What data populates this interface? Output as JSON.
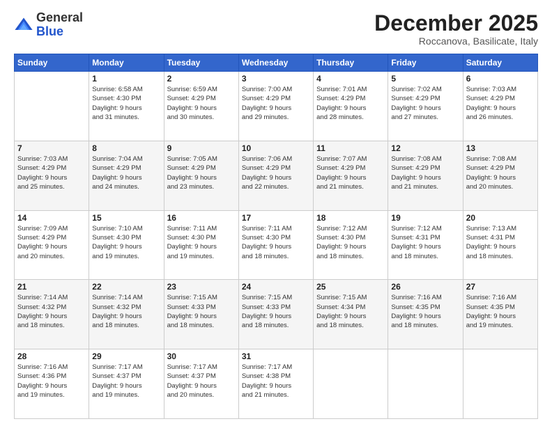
{
  "logo": {
    "general": "General",
    "blue": "Blue"
  },
  "title": "December 2025",
  "location": "Roccanova, Basilicate, Italy",
  "days_header": [
    "Sunday",
    "Monday",
    "Tuesday",
    "Wednesday",
    "Thursday",
    "Friday",
    "Saturday"
  ],
  "weeks": [
    [
      {
        "day": "",
        "info": ""
      },
      {
        "day": "1",
        "info": "Sunrise: 6:58 AM\nSunset: 4:30 PM\nDaylight: 9 hours\nand 31 minutes."
      },
      {
        "day": "2",
        "info": "Sunrise: 6:59 AM\nSunset: 4:29 PM\nDaylight: 9 hours\nand 30 minutes."
      },
      {
        "day": "3",
        "info": "Sunrise: 7:00 AM\nSunset: 4:29 PM\nDaylight: 9 hours\nand 29 minutes."
      },
      {
        "day": "4",
        "info": "Sunrise: 7:01 AM\nSunset: 4:29 PM\nDaylight: 9 hours\nand 28 minutes."
      },
      {
        "day": "5",
        "info": "Sunrise: 7:02 AM\nSunset: 4:29 PM\nDaylight: 9 hours\nand 27 minutes."
      },
      {
        "day": "6",
        "info": "Sunrise: 7:03 AM\nSunset: 4:29 PM\nDaylight: 9 hours\nand 26 minutes."
      }
    ],
    [
      {
        "day": "7",
        "info": "Sunrise: 7:03 AM\nSunset: 4:29 PM\nDaylight: 9 hours\nand 25 minutes."
      },
      {
        "day": "8",
        "info": "Sunrise: 7:04 AM\nSunset: 4:29 PM\nDaylight: 9 hours\nand 24 minutes."
      },
      {
        "day": "9",
        "info": "Sunrise: 7:05 AM\nSunset: 4:29 PM\nDaylight: 9 hours\nand 23 minutes."
      },
      {
        "day": "10",
        "info": "Sunrise: 7:06 AM\nSunset: 4:29 PM\nDaylight: 9 hours\nand 22 minutes."
      },
      {
        "day": "11",
        "info": "Sunrise: 7:07 AM\nSunset: 4:29 PM\nDaylight: 9 hours\nand 21 minutes."
      },
      {
        "day": "12",
        "info": "Sunrise: 7:08 AM\nSunset: 4:29 PM\nDaylight: 9 hours\nand 21 minutes."
      },
      {
        "day": "13",
        "info": "Sunrise: 7:08 AM\nSunset: 4:29 PM\nDaylight: 9 hours\nand 20 minutes."
      }
    ],
    [
      {
        "day": "14",
        "info": "Sunrise: 7:09 AM\nSunset: 4:29 PM\nDaylight: 9 hours\nand 20 minutes."
      },
      {
        "day": "15",
        "info": "Sunrise: 7:10 AM\nSunset: 4:30 PM\nDaylight: 9 hours\nand 19 minutes."
      },
      {
        "day": "16",
        "info": "Sunrise: 7:11 AM\nSunset: 4:30 PM\nDaylight: 9 hours\nand 19 minutes."
      },
      {
        "day": "17",
        "info": "Sunrise: 7:11 AM\nSunset: 4:30 PM\nDaylight: 9 hours\nand 18 minutes."
      },
      {
        "day": "18",
        "info": "Sunrise: 7:12 AM\nSunset: 4:30 PM\nDaylight: 9 hours\nand 18 minutes."
      },
      {
        "day": "19",
        "info": "Sunrise: 7:12 AM\nSunset: 4:31 PM\nDaylight: 9 hours\nand 18 minutes."
      },
      {
        "day": "20",
        "info": "Sunrise: 7:13 AM\nSunset: 4:31 PM\nDaylight: 9 hours\nand 18 minutes."
      }
    ],
    [
      {
        "day": "21",
        "info": "Sunrise: 7:14 AM\nSunset: 4:32 PM\nDaylight: 9 hours\nand 18 minutes."
      },
      {
        "day": "22",
        "info": "Sunrise: 7:14 AM\nSunset: 4:32 PM\nDaylight: 9 hours\nand 18 minutes."
      },
      {
        "day": "23",
        "info": "Sunrise: 7:15 AM\nSunset: 4:33 PM\nDaylight: 9 hours\nand 18 minutes."
      },
      {
        "day": "24",
        "info": "Sunrise: 7:15 AM\nSunset: 4:33 PM\nDaylight: 9 hours\nand 18 minutes."
      },
      {
        "day": "25",
        "info": "Sunrise: 7:15 AM\nSunset: 4:34 PM\nDaylight: 9 hours\nand 18 minutes."
      },
      {
        "day": "26",
        "info": "Sunrise: 7:16 AM\nSunset: 4:35 PM\nDaylight: 9 hours\nand 18 minutes."
      },
      {
        "day": "27",
        "info": "Sunrise: 7:16 AM\nSunset: 4:35 PM\nDaylight: 9 hours\nand 19 minutes."
      }
    ],
    [
      {
        "day": "28",
        "info": "Sunrise: 7:16 AM\nSunset: 4:36 PM\nDaylight: 9 hours\nand 19 minutes."
      },
      {
        "day": "29",
        "info": "Sunrise: 7:17 AM\nSunset: 4:37 PM\nDaylight: 9 hours\nand 19 minutes."
      },
      {
        "day": "30",
        "info": "Sunrise: 7:17 AM\nSunset: 4:37 PM\nDaylight: 9 hours\nand 20 minutes."
      },
      {
        "day": "31",
        "info": "Sunrise: 7:17 AM\nSunset: 4:38 PM\nDaylight: 9 hours\nand 21 minutes."
      },
      {
        "day": "",
        "info": ""
      },
      {
        "day": "",
        "info": ""
      },
      {
        "day": "",
        "info": ""
      }
    ]
  ]
}
